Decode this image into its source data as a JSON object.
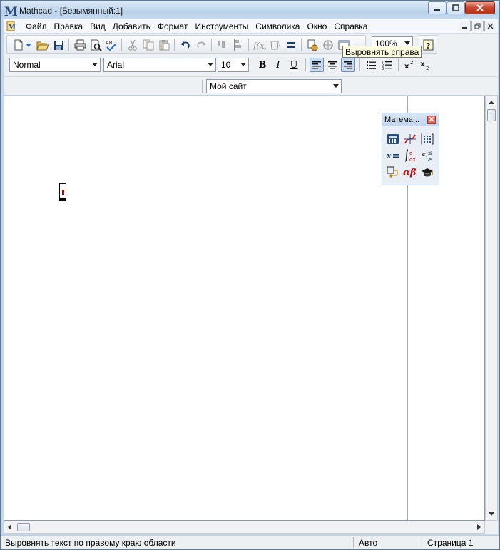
{
  "window": {
    "title": "Mathcad - [Безымянный:1]"
  },
  "menu": {
    "items": [
      {
        "label": "Файл"
      },
      {
        "label": "Правка"
      },
      {
        "label": "Вид"
      },
      {
        "label": "Добавить"
      },
      {
        "label": "Формат"
      },
      {
        "label": "Инструменты"
      },
      {
        "label": "Символика"
      },
      {
        "label": "Окно"
      },
      {
        "label": "Справка"
      }
    ]
  },
  "toolbar": {
    "zoom_value": "100%",
    "style_value": "Normal",
    "font_value": "Arial",
    "font_size_value": "10",
    "bold_label": "B",
    "italic_label": "I",
    "underline_label": "U",
    "resources_value": "Мой сайт",
    "tooltip": "Выровнять справа"
  },
  "palette": {
    "title": "Матема..."
  },
  "statusbar": {
    "message": "Выровнять текст по правому краю области",
    "mode": "Авто",
    "page": "Страница 1"
  },
  "colors": {
    "accent": "#2a6ebb",
    "region_mark": "#c00000"
  }
}
